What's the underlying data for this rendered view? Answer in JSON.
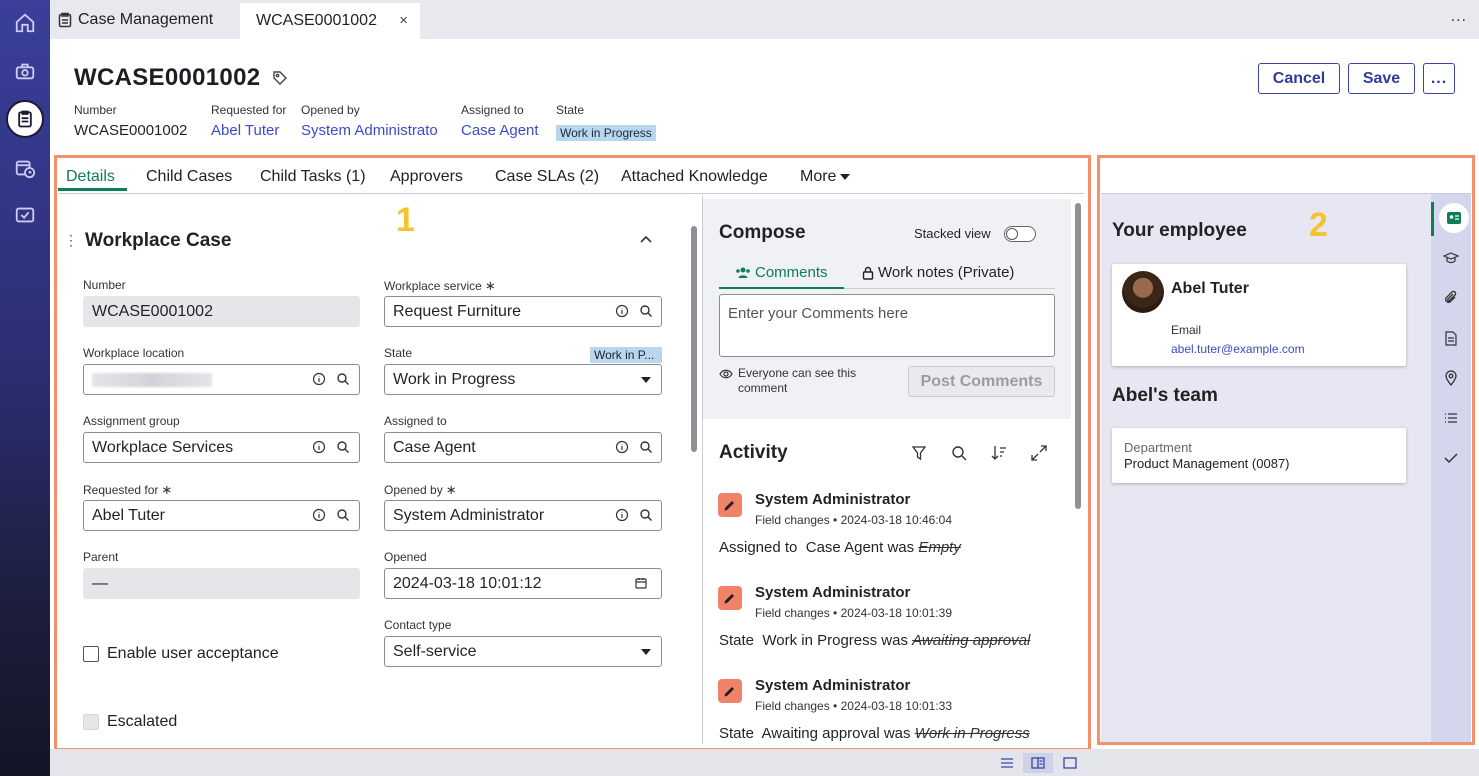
{
  "top_tabs": {
    "app_label": "Case Management",
    "record_tab_label": "WCASE0001002",
    "close_symbol": "×",
    "overflow_symbol": "..."
  },
  "header": {
    "title": "WCASE0001002",
    "cancel_label": "Cancel",
    "save_label": "Save",
    "more_symbol": "...",
    "meta": [
      {
        "label": "Number",
        "value": "WCASE0001002"
      },
      {
        "label": "Requested for",
        "value": "Abel Tuter"
      },
      {
        "label": "Opened by",
        "value": "System Administrato"
      },
      {
        "label": "Assigned to",
        "value": "Case Agent"
      },
      {
        "label": "State",
        "value": "Work in Progress"
      }
    ]
  },
  "form_tabs": [
    "Details",
    "Child Cases",
    "Child Tasks (1)",
    "Approvers",
    "Case SLAs (2)",
    "Attached Knowledge",
    "More"
  ],
  "form": {
    "section_title": "Workplace Case",
    "number": {
      "label": "Number",
      "value": "WCASE0001002"
    },
    "workplace_service": {
      "label": "Workplace service",
      "value": "Request Furniture"
    },
    "workplace_location": {
      "label": "Workplace location"
    },
    "state": {
      "label": "State",
      "value": "Work in Progress",
      "badge": "Work in P..."
    },
    "assignment_group": {
      "label": "Assignment group",
      "value": "Workplace Services"
    },
    "assigned_to": {
      "label": "Assigned to",
      "value": "Case Agent"
    },
    "requested_for": {
      "label": "Requested for",
      "value": "Abel Tuter"
    },
    "opened_by": {
      "label": "Opened by",
      "value": "System Administrator"
    },
    "parent": {
      "label": "Parent",
      "value": "—"
    },
    "opened": {
      "label": "Opened",
      "value": "2024-03-18 10:01:12"
    },
    "contact_type": {
      "label": "Contact type",
      "value": "Self-service"
    },
    "enable_user_acceptance": "Enable user acceptance",
    "escalated": "Escalated",
    "required_mark": "∗"
  },
  "compose": {
    "title": "Compose",
    "stacked_view": "Stacked view",
    "tabs": [
      "Comments",
      "Work notes (Private)"
    ],
    "placeholder": "Enter your Comments here",
    "visibility_note": "Everyone can see this comment",
    "post_label": "Post Comments"
  },
  "activity": {
    "title": "Activity",
    "entries": [
      {
        "who": "System Administrator",
        "kind": "Field changes",
        "time": "2024-03-18 10:46:04",
        "field": "Assigned to",
        "new": "Case Agent was",
        "old": "Empty"
      },
      {
        "who": "System Administrator",
        "kind": "Field changes",
        "time": "2024-03-18 10:01:39",
        "field": "State",
        "new": "Work in Progress was",
        "old": "Awaiting approval"
      },
      {
        "who": "System Administrator",
        "kind": "Field changes",
        "time": "2024-03-18 10:01:33",
        "field": "State",
        "new": "Awaiting approval was",
        "old": "Work in Progress"
      }
    ]
  },
  "side_panel": {
    "title": "Your employee",
    "employee_name": "Abel Tuter",
    "email_label": "Email",
    "email": "abel.tuter@example.com",
    "team_title": "Abel's team",
    "department_label": "Department",
    "department": "Product Management (0087)"
  },
  "annotations": [
    "1",
    "2"
  ],
  "colors": {
    "accent_green": "#0d7d5a",
    "link_blue": "#3c4cc8",
    "button_blue": "#323b9a",
    "annotation_frame": "#f2916b",
    "annotation_number": "#f5c331"
  }
}
